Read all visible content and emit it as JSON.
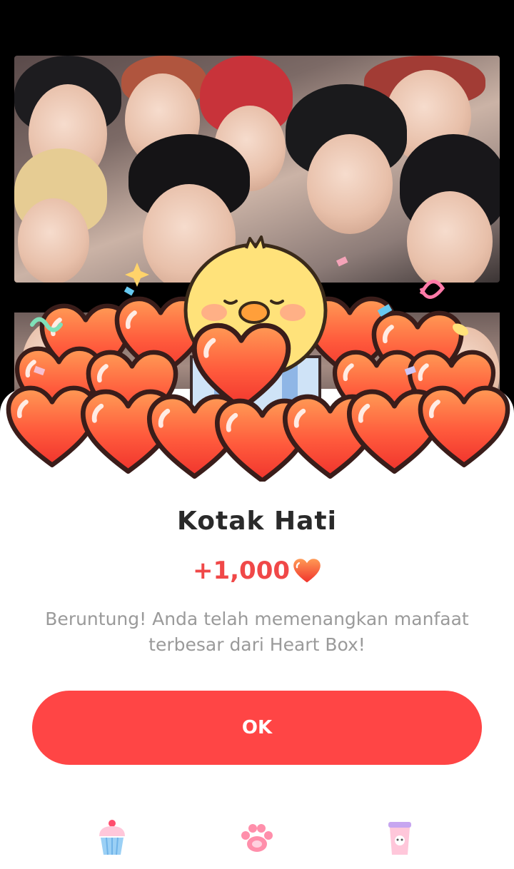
{
  "dialog": {
    "title": "Kotak Hati",
    "reward": "+1,000",
    "message": "Beruntung! Anda telah memenangkan manfaat terbesar dari Heart Box!",
    "ok_label": "OK"
  },
  "icons": {
    "reward": "heart-icon",
    "bottom": [
      "cupcake-icon",
      "paw-icon",
      "cup-icon"
    ]
  },
  "colors": {
    "accent": "#ff4545",
    "reward_text": "#f04848",
    "heart_fill": "#ff5a3c",
    "chick": "#ffe27a"
  }
}
